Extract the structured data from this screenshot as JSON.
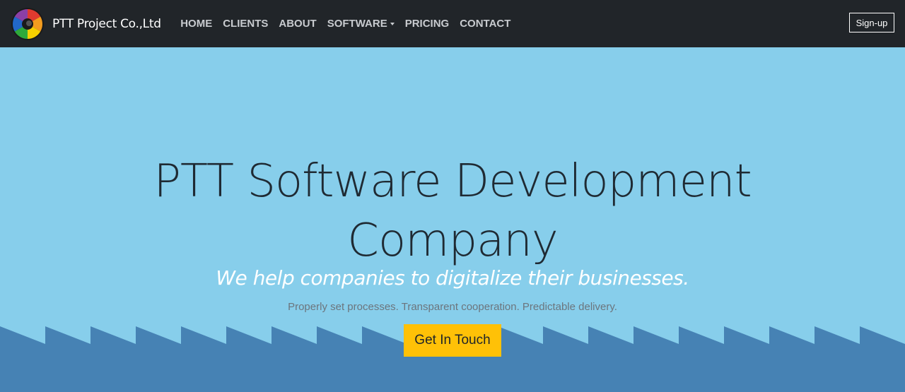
{
  "brand": {
    "name": "PTT Project Co.,Ltd",
    "logo_icon": "rainbow-swirl-logo"
  },
  "nav": {
    "items": [
      {
        "label": "HOME",
        "name": "nav-home"
      },
      {
        "label": "CLIENTS",
        "name": "nav-clients"
      },
      {
        "label": "ABOUT",
        "name": "nav-about"
      },
      {
        "label": "SOFTWARE",
        "name": "nav-software",
        "dropdown": true
      },
      {
        "label": "PRICING",
        "name": "nav-pricing"
      },
      {
        "label": "CONTACT",
        "name": "nav-contact"
      }
    ],
    "signup_label": "Sign-up"
  },
  "hero": {
    "title_line1": "PTT Software Development",
    "title_line2": "Company",
    "tagline": "We help companies to digitalize their businesses.",
    "subtitle": "Properly set processes. Transparent cooperation. Predictable delivery.",
    "cta_label": "Get In Touch"
  },
  "colors": {
    "navbar": "#212529",
    "hero_background": "#87ceeb",
    "wave_foreground": "#4682b4",
    "cta_background": "#ffc107",
    "nav_text": "#c8cbcf"
  }
}
